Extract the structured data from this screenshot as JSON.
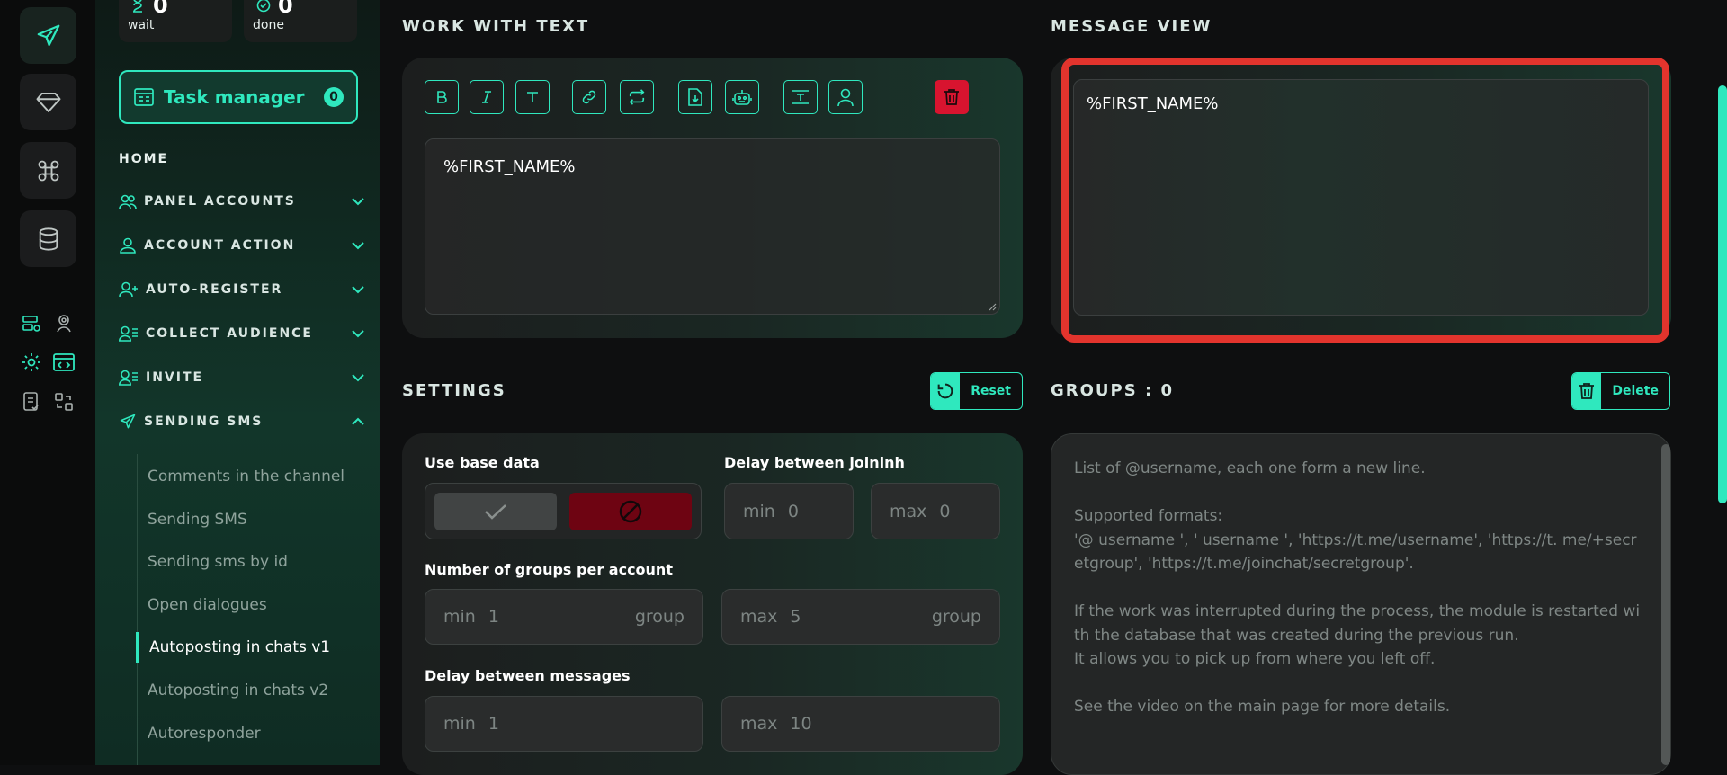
{
  "colors": {
    "accent": "#2fe8be",
    "danger": "#d8142f",
    "highlight": "#e2342d",
    "background": "#0e0f10"
  },
  "stats": [
    {
      "value": "0",
      "label": "wait",
      "icon": "hourglass-icon"
    },
    {
      "value": "0",
      "label": "done",
      "icon": "check-circle-icon"
    }
  ],
  "task_manager": {
    "label": "Task manager",
    "count": "0"
  },
  "nav": {
    "home": "HOME",
    "sections": [
      {
        "label": "PANEL ACCOUNTS",
        "icon": "users-icon",
        "expanded": false
      },
      {
        "label": "ACCOUNT ACTION",
        "icon": "user-icon",
        "expanded": false
      },
      {
        "label": "AUTO-REGISTER",
        "icon": "user-plus-icon",
        "expanded": false
      },
      {
        "label": "COLLECT AUDIENCE",
        "icon": "user-list-icon",
        "expanded": false
      },
      {
        "label": "INVITE",
        "icon": "user-list-icon",
        "expanded": false
      },
      {
        "label": "SENDING SMS",
        "icon": "send-icon",
        "expanded": true
      }
    ],
    "sub_items": [
      "Comments in the channel",
      "Sending SMS",
      "Sending sms by id",
      "Open dialogues",
      "Autoposting in chats v1",
      "Autoposting in chats v2",
      "Autoresponder"
    ],
    "active_sub": "Autoposting in chats v1"
  },
  "work_with_text": {
    "title": "WORK WITH TEXT",
    "tools": [
      "bold-icon",
      "italic-icon",
      "text-icon",
      "link-icon",
      "repeat-icon",
      "file-download-icon",
      "robot-icon",
      "text-align-icon",
      "user-icon",
      "trash-icon"
    ],
    "text_value": "%FIRST_NAME%"
  },
  "message_view": {
    "title": "MESSAGE VIEW",
    "text": "%FIRST_NAME%"
  },
  "settings": {
    "title": "SETTINGS",
    "reset_label": "Reset",
    "use_base_data_label": "Use base data",
    "delay_join_label": "Delay between joininh",
    "delay_join_min_label": "min",
    "delay_join_min": "0",
    "delay_join_max_label": "max",
    "delay_join_max": "0",
    "groups_per_account_label": "Number of groups per account",
    "groups_min_label": "min",
    "groups_min": "1",
    "groups_min_suffix": "group",
    "groups_max_label": "max",
    "groups_max": "5",
    "groups_max_suffix": "group",
    "delay_messages_label": "Delay between messages",
    "msg_min_label": "min",
    "msg_min": "1",
    "msg_max_label": "max",
    "msg_max": "10"
  },
  "groups": {
    "title": "GROUPS : 0",
    "delete_label": "Delete",
    "placeholder": "List of @username, each one form a new line.\n\nSupported formats:\n'@ username ', ' username ', 'https://t.me/username', 'https://t. me/+secretgroup', 'https://t.me/joinchat/secretgroup'.\n\nIf the work was interrupted during the process, the module is restarted with the database that was created during the previous run.\nIt allows you to pick up from where you left off.\n\nSee the video on the main page for more details."
  }
}
